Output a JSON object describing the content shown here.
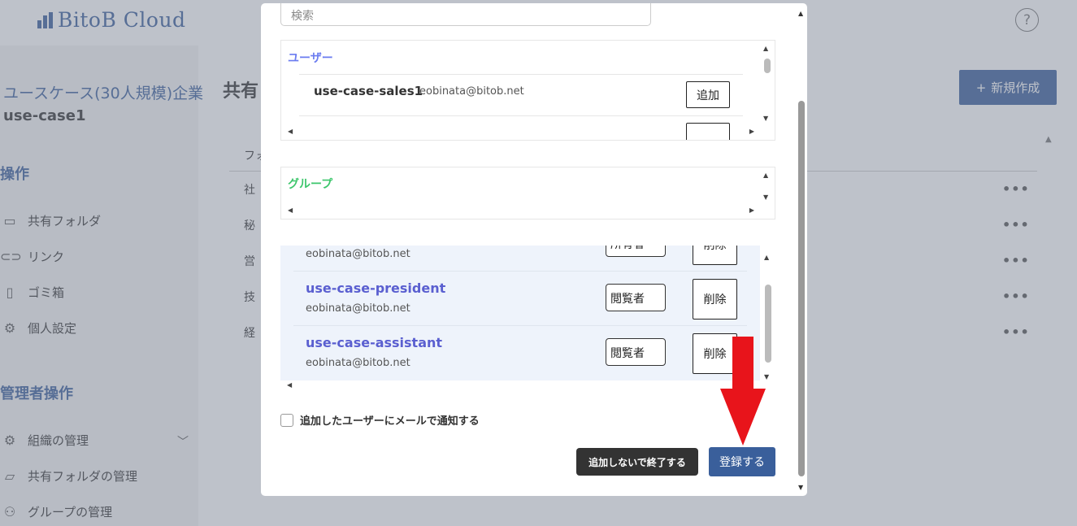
{
  "app": {
    "logo_text": "BitoB Cloud",
    "help_symbol": "?"
  },
  "sidebar": {
    "org_name": "ユースケース(30人規模)企業",
    "org_code": "use-case1",
    "section_ops": "操作",
    "items": [
      {
        "label": "共有フォルダ",
        "icon": "shared-folder-icon"
      },
      {
        "label": "リンク",
        "icon": "link-icon"
      },
      {
        "label": "ゴミ箱",
        "icon": "trash-icon"
      },
      {
        "label": "個人設定",
        "icon": "gear-icon"
      }
    ],
    "section_admin": "管理者操作",
    "admin_items": [
      {
        "label": "組織の管理",
        "icon": "gear-icon"
      },
      {
        "label": "共有フォルダの管理",
        "icon": "folder-icon"
      },
      {
        "label": "グループの管理",
        "icon": "group-icon"
      }
    ]
  },
  "main": {
    "title": "共有",
    "new_button": "新規作成",
    "column_header": "フォ",
    "rows": [
      "社",
      "秘",
      "営",
      "技",
      "経"
    ],
    "row_menu": "•••"
  },
  "modal": {
    "search_placeholder": "検索",
    "users_title": "ユーザー",
    "users": [
      {
        "name": "use-case-sales1",
        "email": "eobinata@bitob.net",
        "add_label": "追加"
      }
    ],
    "groups_title": "グループ",
    "members": [
      {
        "name": "",
        "email": "eobinata@bitob.net",
        "role": "所有者",
        "delete_label": "削除"
      },
      {
        "name": "use-case-president",
        "email": "eobinata@bitob.net",
        "role": "閲覧者",
        "delete_label": "削除"
      },
      {
        "name": "use-case-assistant",
        "email": "eobinata@bitob.net",
        "role": "閲覧者",
        "delete_label": "削除"
      }
    ],
    "notify_label": "追加したユーザーにメールで通知する",
    "exit_button": "追加しないで終了する",
    "register_button": "登録する"
  },
  "colors": {
    "brand": "#3a5f9b",
    "users_title": "#6b7cf0",
    "groups_title": "#3dc66c",
    "member_name": "#5a5fd0",
    "arrow": "#e8141b"
  }
}
